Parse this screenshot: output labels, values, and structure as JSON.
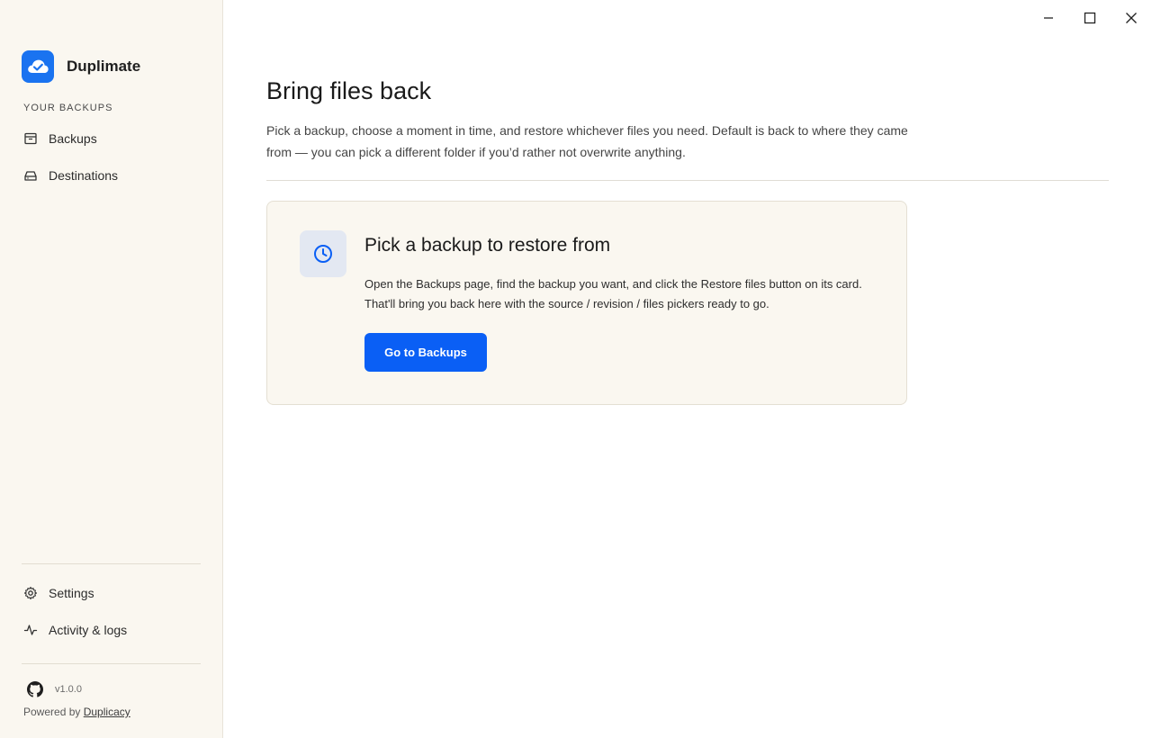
{
  "app": {
    "name": "Duplimate",
    "version": "v1.0.0"
  },
  "sidebar": {
    "section_label": "YOUR BACKUPS",
    "items": [
      {
        "label": "Backups",
        "icon": "archive-icon"
      },
      {
        "label": "Destinations",
        "icon": "drive-icon"
      }
    ],
    "bottom_items": [
      {
        "label": "Settings",
        "icon": "gear-icon"
      },
      {
        "label": "Activity & logs",
        "icon": "activity-icon"
      }
    ],
    "footer": {
      "powered_prefix": "Powered by",
      "powered_link": "Duplicacy"
    }
  },
  "main": {
    "title": "Bring files back",
    "description": "Pick a backup, choose a moment in time, and restore whichever files you need. Default is back to where they came from — you can pick a different folder if you’d rather not overwrite anything.",
    "card": {
      "title": "Pick a backup to restore from",
      "text": "Open the Backups page, find the backup you want, and click the Restore files button on its card. That'll bring you back here with the source / revision / files pickers ready to go.",
      "button_label": "Go to Backups",
      "icon": "clock-icon"
    }
  },
  "colors": {
    "accent": "#0a5ff5",
    "sidebar_bg": "#faf7f0",
    "card_bg": "#faf7f0"
  }
}
